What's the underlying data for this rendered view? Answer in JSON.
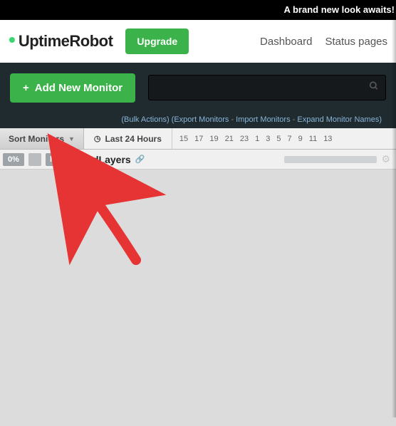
{
  "banner": {
    "text": "A brand new look awaits! "
  },
  "logo": {
    "text": "UptimeRobot"
  },
  "nav": {
    "upgrade": "Upgrade",
    "dashboard": "Dashboard",
    "status_pages": "Status pages"
  },
  "actions": {
    "add_monitor": "Add New Monitor",
    "search_placeholder": ""
  },
  "bulk_links": {
    "bulk_actions": "(Bulk Actions)",
    "export_monitors": "(Export Monitors",
    "import_monitors": "Import Monitors",
    "expand_names": "Expand Monitor Names)"
  },
  "toolbar": {
    "sort_label": "Sort Monitors",
    "last24_label": "Last 24 Hours",
    "hours": [
      "15",
      "17",
      "19",
      "21",
      "23",
      "1",
      "3",
      "5",
      "7",
      "9",
      "11",
      "13"
    ]
  },
  "monitor": {
    "uptime_pct": "0%",
    "type": "http",
    "name": "QuadLayers"
  },
  "colors": {
    "green": "#3bb34a",
    "dark": "#1f2b2f",
    "red": "#e63434"
  }
}
